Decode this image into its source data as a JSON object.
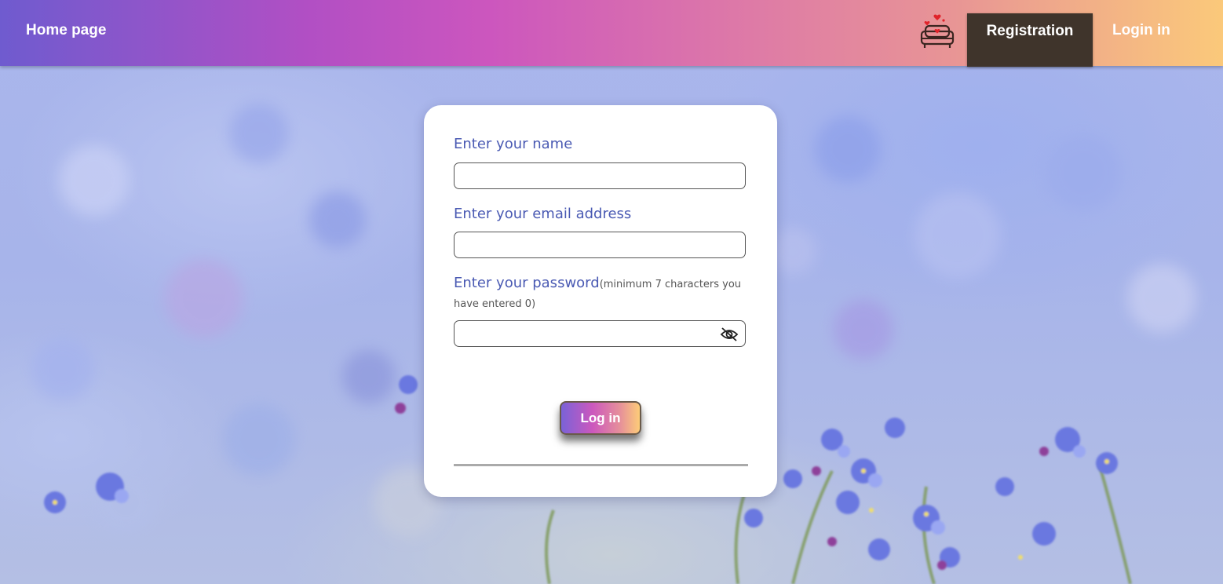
{
  "navbar": {
    "home_label": "Home page",
    "logo_icon": "sofa-hearts-icon",
    "registration_label": "Registration",
    "login_label": "Login in",
    "gradient": [
      "#6f5bcf",
      "#cc56be",
      "#e89595",
      "#fbc97a"
    ],
    "active_tab_color": "#3f342b"
  },
  "form": {
    "name_label": "Enter your name",
    "name_value": "",
    "email_label": "Enter your email address",
    "email_value": "",
    "password_label": "Enter your password",
    "password_hint": "(minimum 7 characters you have entered 0)",
    "password_value": "",
    "password_toggle_icon": "eye-slash-icon",
    "submit_label": "Log in",
    "label_color": "#4a5ab3"
  },
  "background": {
    "description_icon": "forget-me-not-flowers-photo"
  }
}
